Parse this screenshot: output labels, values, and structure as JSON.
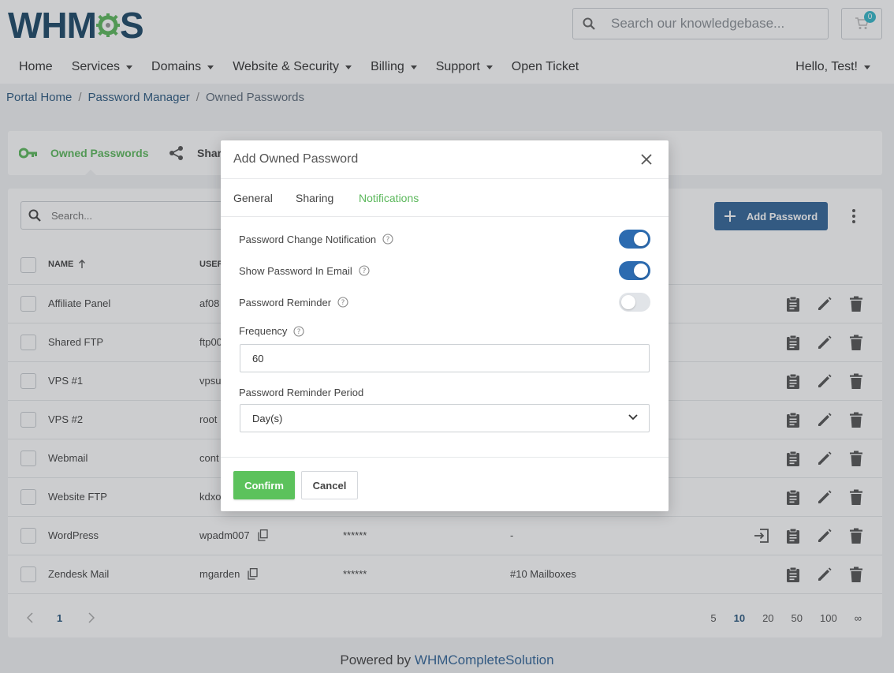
{
  "header": {
    "logo_text": "WHM",
    "logo_text_end": "S",
    "search_placeholder": "Search our knowledgebase...",
    "cart_count": "0",
    "greeting": "Hello, Test!"
  },
  "nav": {
    "items": [
      {
        "label": "Home",
        "dropdown": false
      },
      {
        "label": "Services",
        "dropdown": true
      },
      {
        "label": "Domains",
        "dropdown": true
      },
      {
        "label": "Website & Security",
        "dropdown": true
      },
      {
        "label": "Billing",
        "dropdown": true
      },
      {
        "label": "Support",
        "dropdown": true
      },
      {
        "label": "Open Ticket",
        "dropdown": false
      }
    ]
  },
  "breadcrumb": {
    "items": [
      "Portal Home",
      "Password Manager",
      "Owned Passwords"
    ]
  },
  "tabs": {
    "owned": "Owned Passwords",
    "shared": "Shar"
  },
  "list": {
    "search_placeholder": "Search...",
    "add_button": "Add Password",
    "columns": {
      "name": "Name",
      "username": "User"
    },
    "rows": [
      {
        "name": "Affiliate Panel",
        "username": "af08",
        "password": "",
        "note": "",
        "login": false
      },
      {
        "name": "Shared FTP",
        "username": "ftp00",
        "password": "",
        "note": "",
        "login": false
      },
      {
        "name": "VPS #1",
        "username": "vpsu",
        "password": "",
        "note": "",
        "login": false
      },
      {
        "name": "VPS #2",
        "username": "root",
        "password": "",
        "note": "",
        "login": false
      },
      {
        "name": "Webmail",
        "username": "cont",
        "password": "",
        "note": "",
        "login": false
      },
      {
        "name": "Website FTP",
        "username": "kdxo",
        "password": "",
        "note": "",
        "login": false
      },
      {
        "name": "WordPress",
        "username": "wpadm007",
        "password": "******",
        "note": "-",
        "login": true
      },
      {
        "name": "Zendesk Mail",
        "username": "mgarden",
        "password": "******",
        "note": "#10 Mailboxes",
        "login": false
      }
    ],
    "pagination": {
      "current_page": "1",
      "per_page_options": [
        "5",
        "10",
        "20",
        "50",
        "100",
        "∞"
      ],
      "per_page_selected": "10"
    }
  },
  "footer": {
    "prefix": "Powered by ",
    "brand": "WHMCompleteSolution"
  },
  "modal": {
    "title": "Add Owned Password",
    "tabs": [
      "General",
      "Sharing",
      "Notifications"
    ],
    "active_tab": "Notifications",
    "toggles": [
      {
        "label": "Password Change Notification",
        "on": true
      },
      {
        "label": "Show Password In Email",
        "on": true
      },
      {
        "label": "Password Reminder",
        "on": false
      }
    ],
    "frequency_label": "Frequency",
    "frequency_value": "60",
    "period_label": "Password Reminder Period",
    "period_value": "Day(s)",
    "confirm": "Confirm",
    "cancel": "Cancel"
  },
  "colors": {
    "brand_blue": "#1d4867",
    "accent_green": "#5cb85c",
    "primary_button": "#336699",
    "toggle_on": "#2c6bb0"
  }
}
